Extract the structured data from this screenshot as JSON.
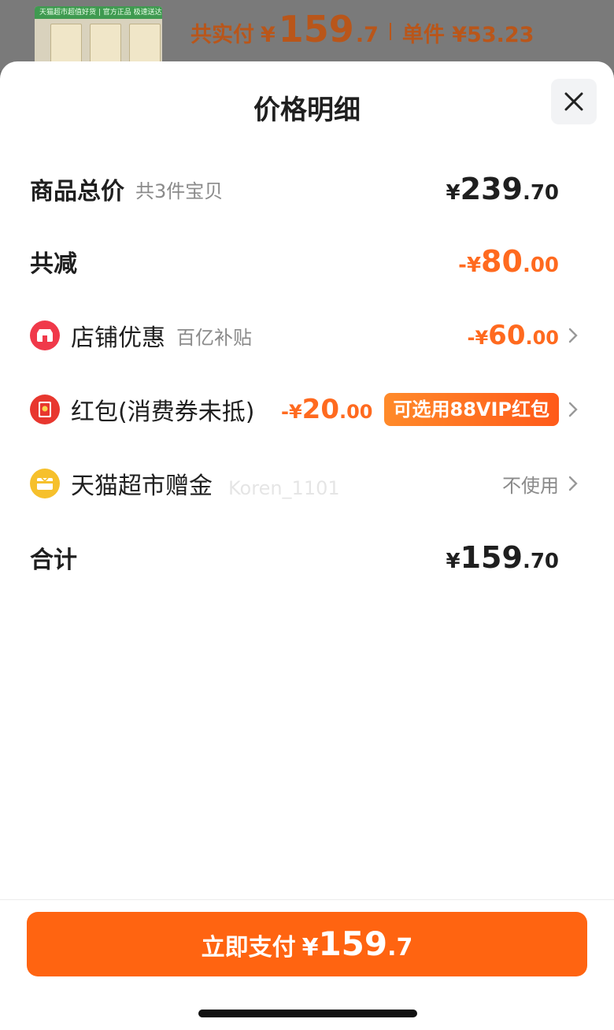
{
  "background": {
    "thumb_banner": "天猫超市超值好货 | 官方正品 极速送达",
    "summary_label": "共实付",
    "summary_yen": "¥",
    "summary_int": "159",
    "summary_dec": ".7",
    "unit_price": "单件 ¥53.23"
  },
  "sheet": {
    "title": "价格明细",
    "close_icon": "close-icon"
  },
  "rows": {
    "total": {
      "label": "商品总价",
      "sub": "共3件宝贝",
      "yen": "¥",
      "int": "239",
      "dec": ".70"
    },
    "reduced": {
      "label": "共减",
      "yen": "-¥",
      "int": "80",
      "dec": ".00"
    },
    "store": {
      "icon": "store-discount-icon",
      "label": "店铺优惠",
      "sub": "百亿补贴",
      "yen": "-¥",
      "int": "60",
      "dec": ".00"
    },
    "redpacket": {
      "icon": "red-packet-icon",
      "label": "红包(消费券未抵)",
      "yen": "-¥",
      "int": "20",
      "dec": ".00",
      "tag": "可选用88VIP红包"
    },
    "gift": {
      "icon": "gift-card-icon",
      "label": "天猫超市赠金",
      "status": "不使用"
    },
    "sum": {
      "label": "合计",
      "yen": "¥",
      "int": "159",
      "dec": ".70"
    }
  },
  "watermark": "Koren_1101",
  "pay_button": {
    "label": "立即支付",
    "yen": "¥",
    "int": "159",
    "dec": ".7"
  },
  "colors": {
    "accent": "#ff6411",
    "discount": "#ff6a1f",
    "store_icon": "#f0394a",
    "redpacket_icon": "#e8372f",
    "gift_icon": "#f6c02c"
  }
}
